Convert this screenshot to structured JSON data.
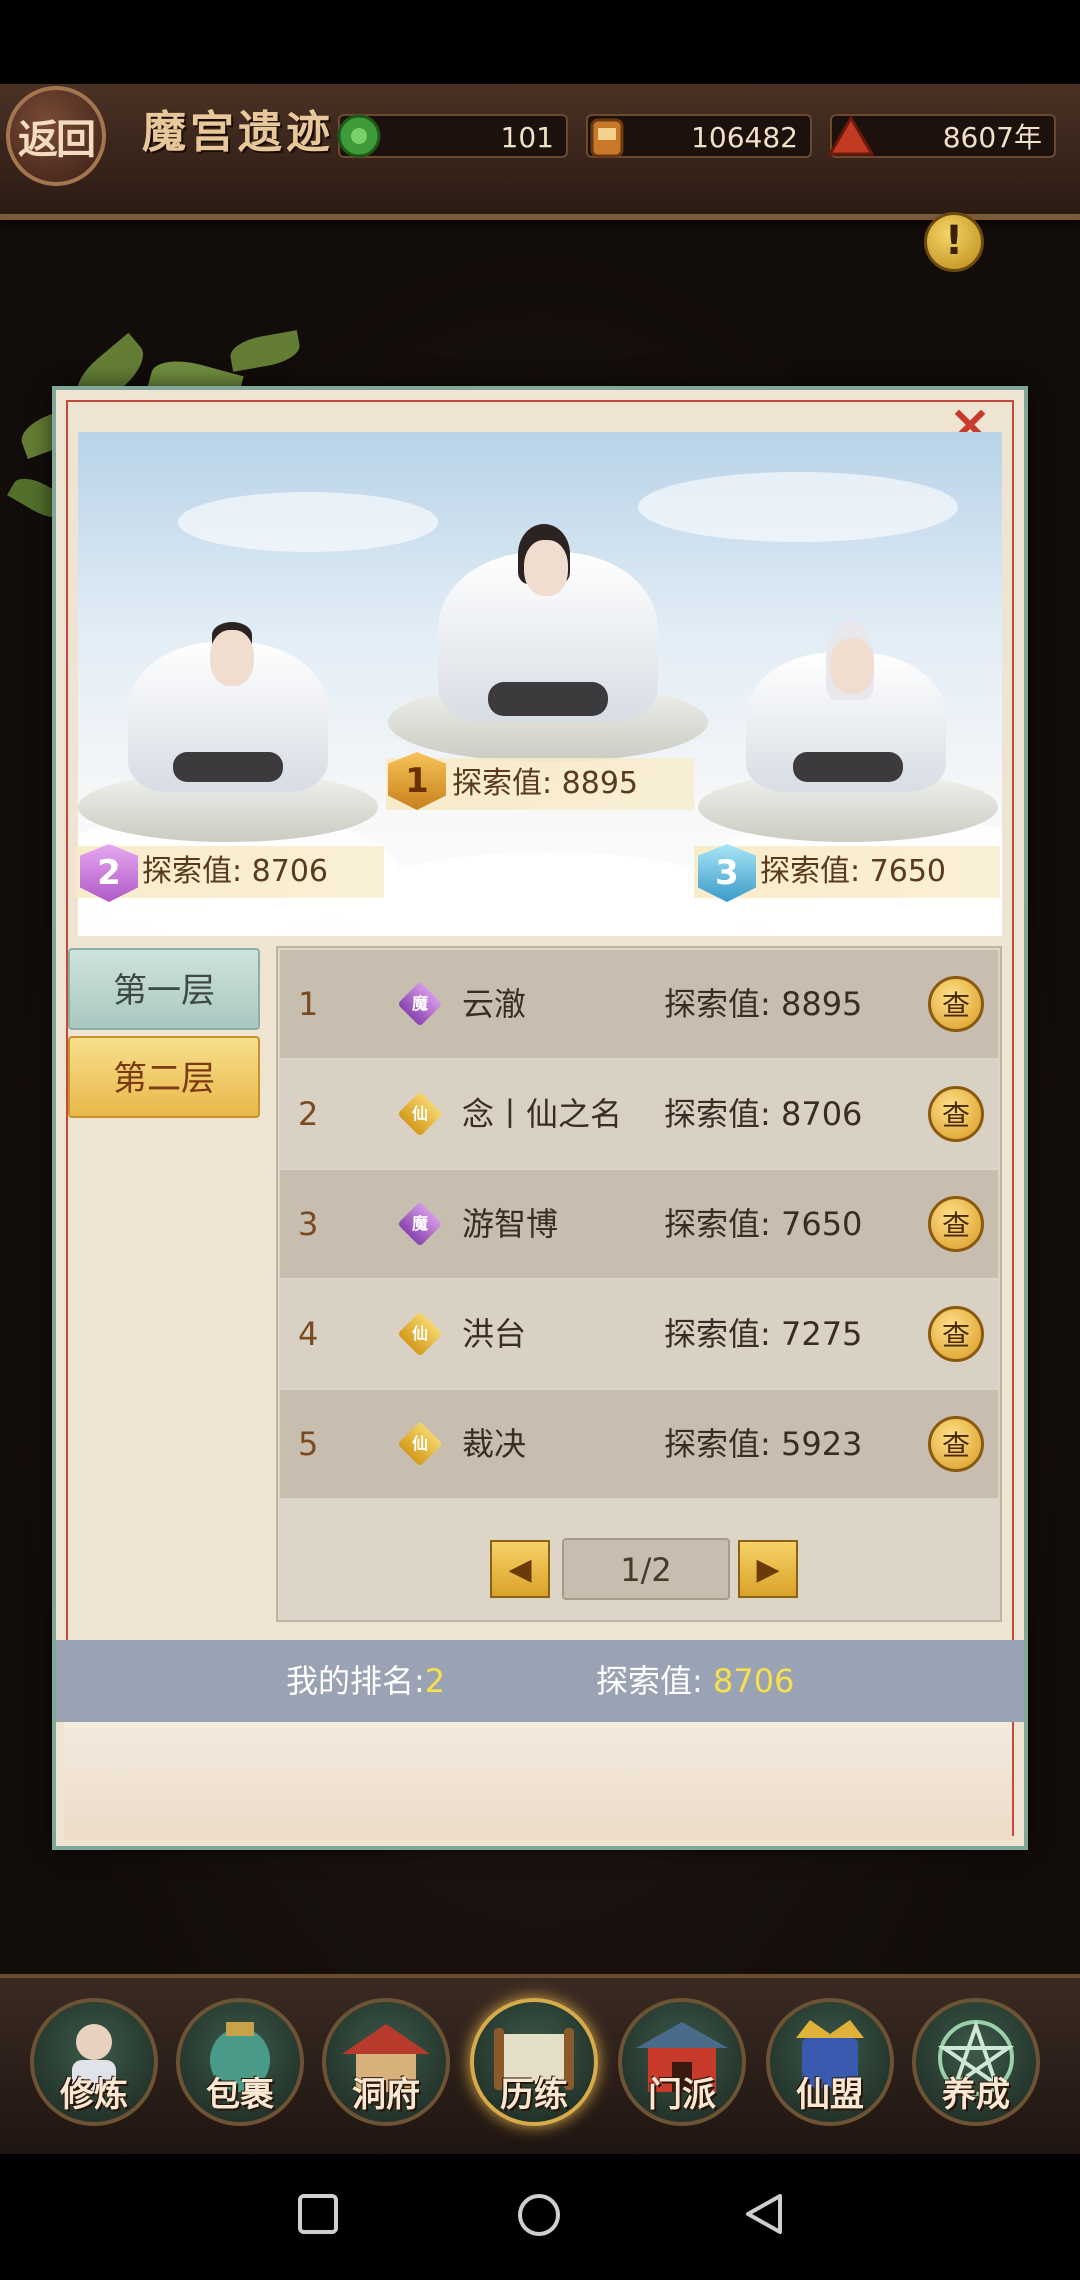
{
  "header": {
    "back_label": "返回",
    "title": "魔宫遗迹",
    "resources": [
      {
        "icon": "jade-coin-icon",
        "value": "101"
      },
      {
        "icon": "treasure-bag-icon",
        "value": "106482"
      },
      {
        "icon": "mountain-icon",
        "value": "8607年"
      }
    ]
  },
  "info_button": "!",
  "close_button": "×",
  "podium": [
    {
      "rank": "1",
      "label": "探索值:",
      "value": "8895"
    },
    {
      "rank": "2",
      "label": "探索值:",
      "value": "8706"
    },
    {
      "rank": "3",
      "label": "探索值:",
      "value": "7650"
    }
  ],
  "tabs": [
    {
      "label": "第一层",
      "active": false
    },
    {
      "label": "第二层",
      "active": true
    }
  ],
  "ranking": [
    {
      "rank": "1",
      "sect": "魔",
      "name": "云澈",
      "score_label": "探索值:",
      "score": "8895",
      "view": "查"
    },
    {
      "rank": "2",
      "sect": "仙",
      "name": "念丨仙之名",
      "score_label": "探索值:",
      "score": "8706",
      "view": "查"
    },
    {
      "rank": "3",
      "sect": "魔",
      "name": "游智博",
      "score_label": "探索值:",
      "score": "7650",
      "view": "查"
    },
    {
      "rank": "4",
      "sect": "仙",
      "name": "洪台",
      "score_label": "探索值:",
      "score": "7275",
      "view": "查"
    },
    {
      "rank": "5",
      "sect": "仙",
      "name": "裁决",
      "score_label": "探索值:",
      "score": "5923",
      "view": "查"
    }
  ],
  "pager": {
    "page": "1/2"
  },
  "my_rank": {
    "rank_label": "我的排名:",
    "rank": "2",
    "score_label": "探索值:",
    "score": "8706"
  },
  "nav": [
    {
      "label": "修炼",
      "icon": "cultivate-icon"
    },
    {
      "label": "包裹",
      "icon": "bag-icon"
    },
    {
      "label": "洞府",
      "icon": "cave-icon"
    },
    {
      "label": "历练",
      "icon": "scroll-icon",
      "active": true
    },
    {
      "label": "门派",
      "icon": "sect-gate-icon"
    },
    {
      "label": "仙盟",
      "icon": "alliance-icon"
    },
    {
      "label": "养成",
      "icon": "pentagram-icon"
    }
  ]
}
